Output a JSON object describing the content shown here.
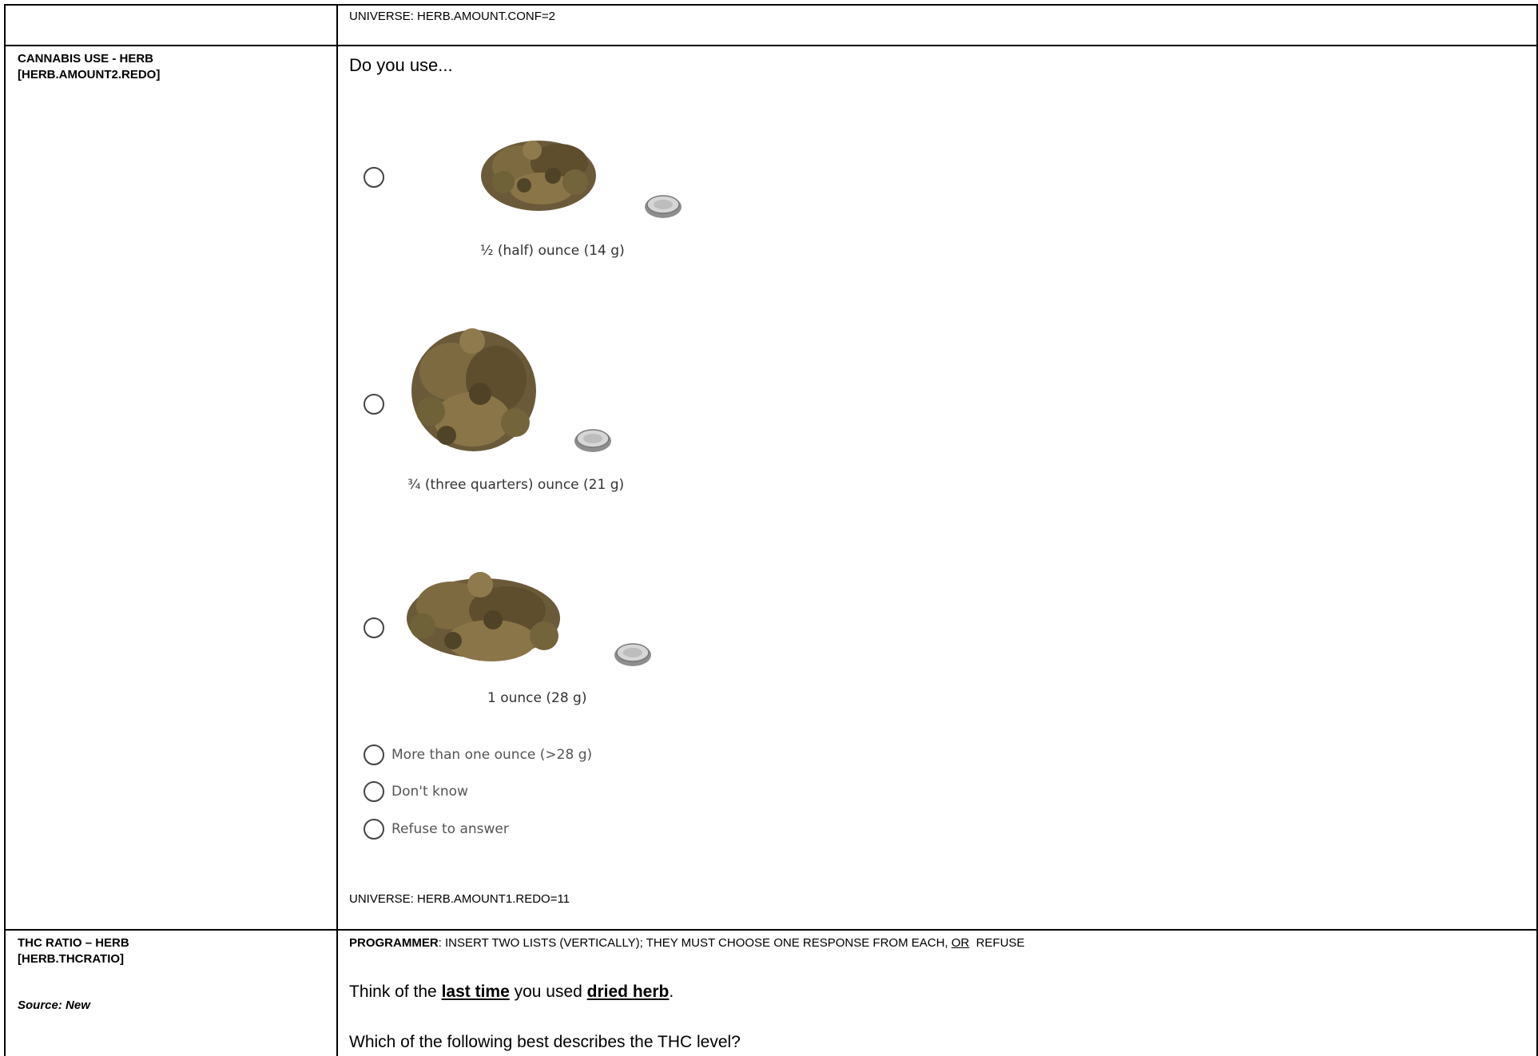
{
  "row1": {
    "universe": "UNIVERSE: HERB.AMOUNT.CONF=2"
  },
  "row2": {
    "label_line1": "CANNABIS USE - HERB",
    "label_line2": "[HERB.AMOUNT2.REDO]",
    "question": "Do you use...",
    "image_options": [
      {
        "caption": "½ (half) ounce (14 g)",
        "image": "cannabis-pile-half-ounce-with-bottle-cap"
      },
      {
        "caption": "¾ (three quarters) ounce (21 g)",
        "image": "cannabis-pile-three-quarters-ounce-with-bottle-cap"
      },
      {
        "caption": "1 ounce (28 g)",
        "image": "cannabis-pile-one-ounce-with-bottle-cap"
      }
    ],
    "text_options": [
      "More than one ounce (>28 g)",
      "Don't know",
      "Refuse to answer"
    ],
    "universe": "UNIVERSE: HERB.AMOUNT1.REDO=11"
  },
  "row3": {
    "label_line1": "THC RATIO – HERB",
    "label_line2": "[HERB.THCRATIO]",
    "source": "Source: New",
    "programmer_label": "PROGRAMMER",
    "programmer_text": ": INSERT TWO LISTS (VERTICALLY); THEY MUST CHOOSE ONE RESPONSE FROM EACH, ",
    "programmer_or": "OR",
    "programmer_end": "  REFUSE",
    "think_pre": "Think of the ",
    "think_last_time": "last time",
    "think_mid": " you used ",
    "think_dried_herb": "dried herb",
    "think_end": ".",
    "which": "Which of the following best describes the THC level?"
  }
}
